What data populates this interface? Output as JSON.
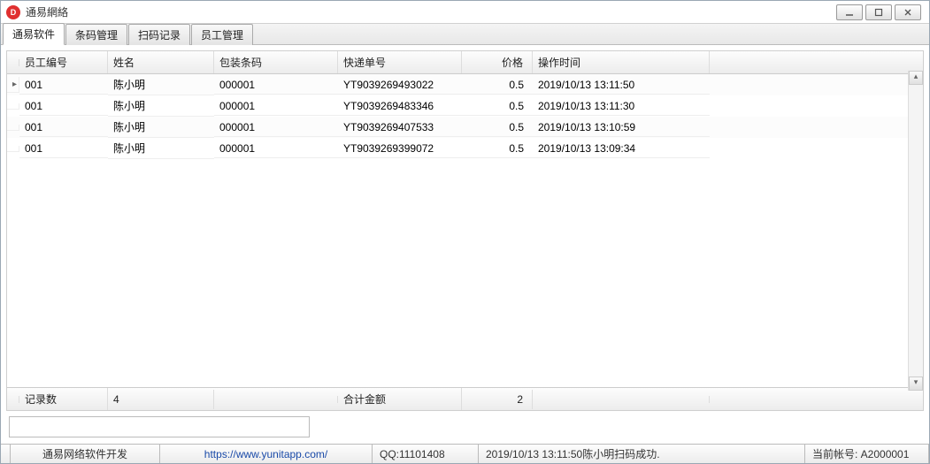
{
  "window": {
    "title": "通易網絡"
  },
  "tabs": [
    {
      "label": "通易软件"
    },
    {
      "label": "条码管理"
    },
    {
      "label": "扫码记录"
    },
    {
      "label": "员工管理"
    }
  ],
  "columns": {
    "emp_id": "员工编号",
    "name": "姓名",
    "barcode": "包装条码",
    "express": "快递单号",
    "price": "价格",
    "optime": "操作时间"
  },
  "rows": [
    {
      "indicator": "▸",
      "emp_id": "001",
      "name": "陈小明",
      "barcode": "000001",
      "express": "YT9039269493022",
      "price": "0.5",
      "optime": "2019/10/13 13:11:50"
    },
    {
      "indicator": "",
      "emp_id": "001",
      "name": "陈小明",
      "barcode": "000001",
      "express": "YT9039269483346",
      "price": "0.5",
      "optime": "2019/10/13 13:11:30"
    },
    {
      "indicator": "",
      "emp_id": "001",
      "name": "陈小明",
      "barcode": "000001",
      "express": "YT9039269407533",
      "price": "0.5",
      "optime": "2019/10/13 13:10:59"
    },
    {
      "indicator": "",
      "emp_id": "001",
      "name": "陈小明",
      "barcode": "000001",
      "express": "YT9039269399072",
      "price": "0.5",
      "optime": "2019/10/13 13:09:34"
    }
  ],
  "footer": {
    "count_label": "记录数",
    "count_value": "4",
    "sum_label": "合计金额",
    "sum_value": "2"
  },
  "input": {
    "value": ""
  },
  "status": {
    "company": "通易网络软件开发",
    "url": "https://www.yunitapp.com/",
    "qq": "QQ:11101408",
    "msg": "2019/10/13 13:11:50陈小明扫码成功.",
    "account": "当前帐号: A2000001"
  }
}
